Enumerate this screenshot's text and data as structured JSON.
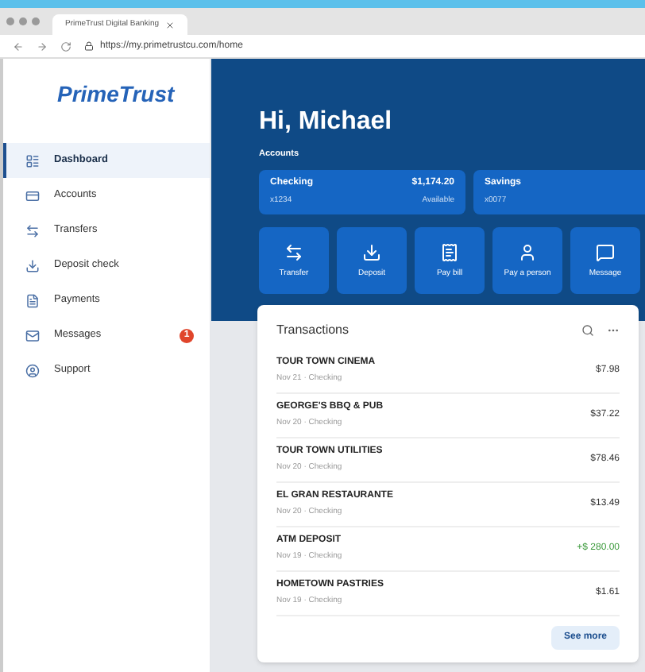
{
  "browser": {
    "tab_title": "PrimeTrust Digital Banking",
    "url": "https://my.primetrustcu.com/home"
  },
  "sidebar": {
    "logo": "PrimeTrust",
    "items": [
      {
        "label": "Dashboard",
        "kind": "dashboard",
        "selected": true
      },
      {
        "label": "Accounts",
        "kind": "card",
        "selected": false
      },
      {
        "label": "Transfers",
        "kind": "transfer",
        "selected": false
      },
      {
        "label": "Deposit check",
        "kind": "deposit",
        "selected": false
      },
      {
        "label": "Payments",
        "kind": "file",
        "selected": false
      },
      {
        "label": "Messages",
        "kind": "mail",
        "selected": false,
        "badge": "1"
      },
      {
        "label": "Support",
        "kind": "support",
        "selected": false
      }
    ]
  },
  "header": {
    "greeting": "Hi, Michael",
    "section_label": "Accounts",
    "accounts": [
      {
        "name": "Checking",
        "number": "x1234",
        "balance": "$1,174.20",
        "balance_label": "Available"
      },
      {
        "name": "Savings",
        "number": "x0077"
      }
    ]
  },
  "actions": [
    {
      "label": "Transfer",
      "kind": "transfer"
    },
    {
      "label": "Deposit",
      "kind": "deposit"
    },
    {
      "label": "Pay bill",
      "kind": "bill"
    },
    {
      "label": "Pay a person",
      "kind": "person"
    },
    {
      "label": "Message",
      "kind": "message"
    }
  ],
  "transactions": {
    "title": "Transactions",
    "see_more": "See more",
    "rows": [
      {
        "name": "TOUR TOWN CINEMA",
        "detail": "Nov 21 · Checking",
        "amount": "$7.98",
        "kind": "debit"
      },
      {
        "name": "GEORGE'S BBQ & PUB",
        "detail": "Nov 20 · Checking",
        "amount": "$37.22",
        "kind": "debit"
      },
      {
        "name": "TOUR TOWN UTILITIES",
        "detail": "Nov 20 · Checking",
        "amount": "$78.46",
        "kind": "debit"
      },
      {
        "name": "EL GRAN RESTAURANTE",
        "detail": "Nov 20 · Checking",
        "amount": "$13.49",
        "kind": "debit"
      },
      {
        "name": "ATM DEPOSIT",
        "detail": "Nov 19 · Checking",
        "amount": "+$ 280.00",
        "kind": "credit"
      },
      {
        "name": "HOMETOWN PASTRIES",
        "detail": "Nov 19 · Checking",
        "amount": "$1.61",
        "kind": "debit"
      }
    ]
  }
}
